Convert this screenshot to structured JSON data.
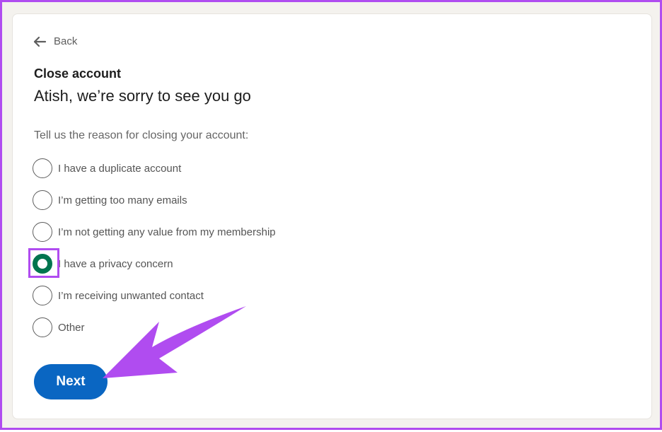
{
  "back": {
    "label": "Back",
    "icon": "arrow-left-icon"
  },
  "header": {
    "title": "Close account",
    "subtitle": "Atish, we’re sorry to see you go"
  },
  "form": {
    "prompt": "Tell us the reason for closing your account:",
    "options": [
      {
        "label": "I have a duplicate account",
        "selected": false
      },
      {
        "label": "I’m getting too many emails",
        "selected": false
      },
      {
        "label": "I’m not getting any value from my membership",
        "selected": false
      },
      {
        "label": "I have a privacy concern",
        "selected": true
      },
      {
        "label": "I’m receiving unwanted contact",
        "selected": false
      },
      {
        "label": "Other",
        "selected": false
      }
    ],
    "next_label": "Next"
  },
  "colors": {
    "accent_primary": "#0a66c2",
    "radio_selected": "#01754f",
    "annotation": "#b04cf0"
  }
}
